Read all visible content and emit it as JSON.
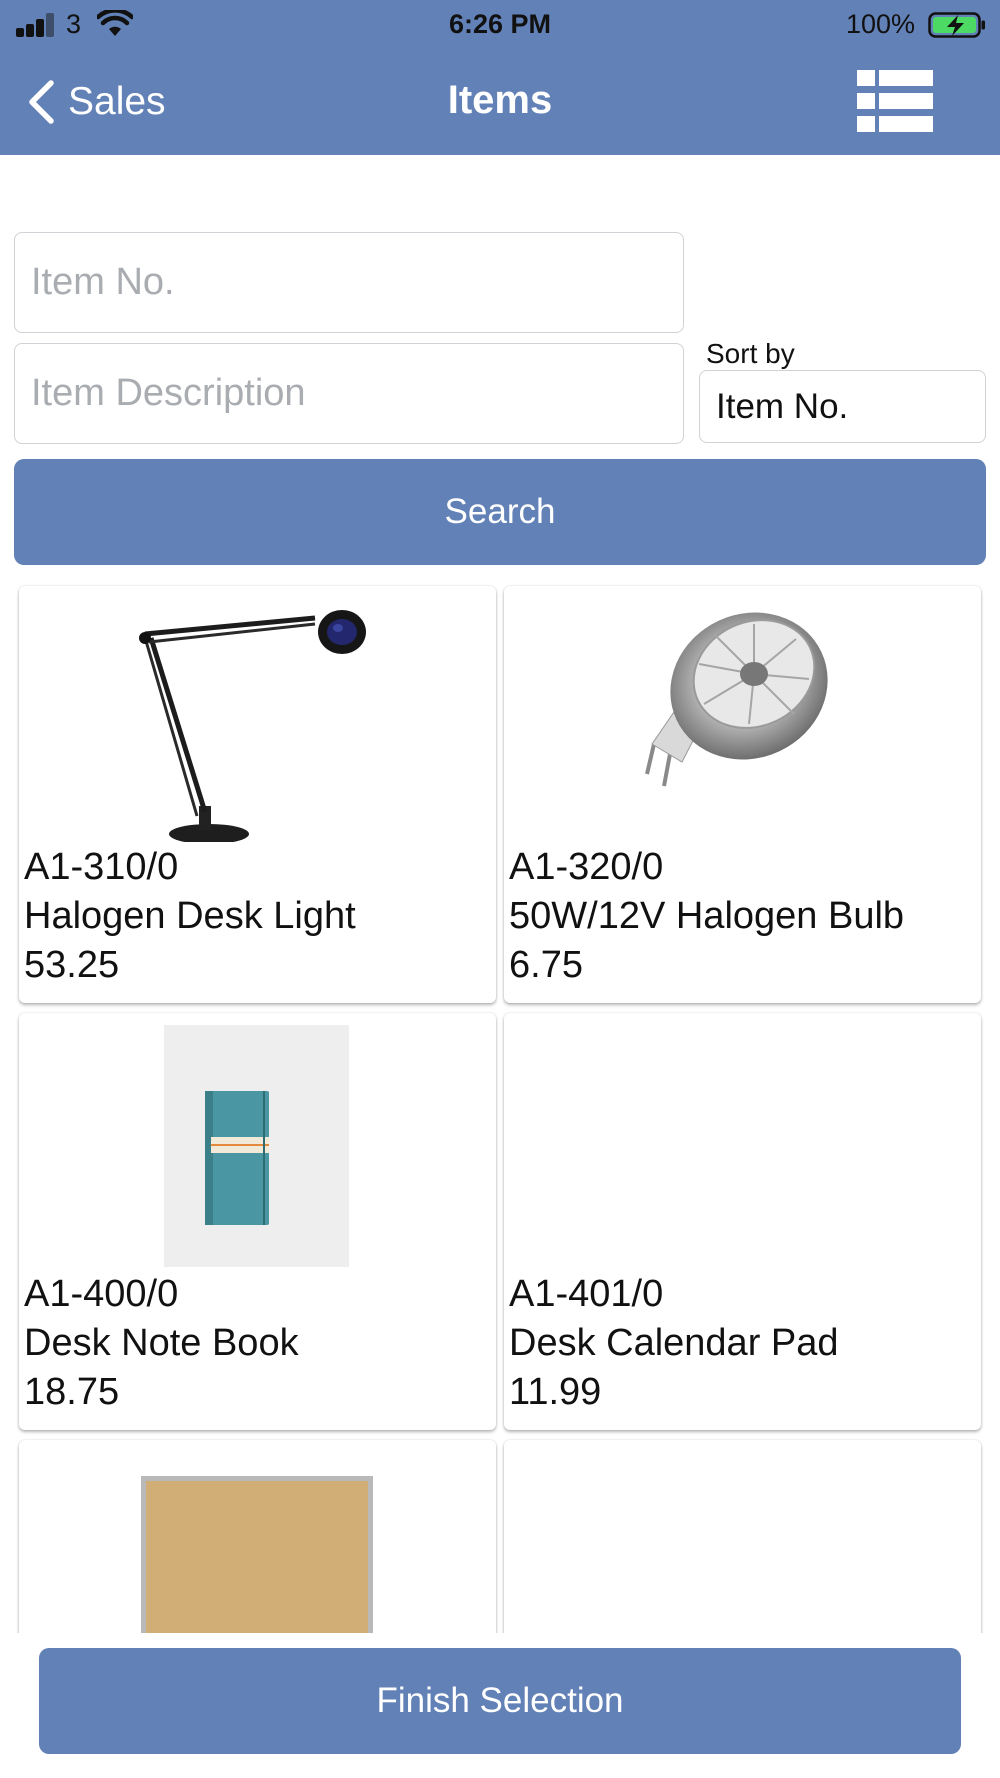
{
  "status_bar": {
    "carrier": "3",
    "time": "6:26 PM",
    "battery": "100%",
    "icons": [
      "signal-bars-icon",
      "wifi-icon",
      "battery-charging-icon"
    ]
  },
  "nav": {
    "back_label": "Sales",
    "title": "Items",
    "view_toggle_icon": "list-view-icon"
  },
  "search": {
    "item_no_placeholder": "Item No.",
    "item_no_value": "",
    "item_desc_placeholder": "Item Description",
    "item_desc_value": "",
    "sort_label": "Sort by",
    "sort_value": "Item No.",
    "button_label": "Search"
  },
  "items": [
    {
      "number": "A1-310/0",
      "description": "Halogen Desk Light",
      "price": "53.25",
      "image": "desk-lamp"
    },
    {
      "number": "A1-320/0",
      "description": "50W/12V Halogen Bulb",
      "price": "6.75",
      "image": "halogen-bulb"
    },
    {
      "number": "A1-400/0",
      "description": "Desk Note Book",
      "price": "18.75",
      "image": "notebook"
    },
    {
      "number": "A1-401/0",
      "description": "Desk Calendar Pad",
      "price": "11.99",
      "image": ""
    },
    {
      "number": "",
      "description": "",
      "price": "",
      "image": "cork-board"
    },
    {
      "number": "",
      "description": "",
      "price": "",
      "image": ""
    }
  ],
  "footer": {
    "finish_label": "Finish Selection"
  },
  "colors": {
    "accent": "#6281b6",
    "battery_fill": "#4cd964"
  }
}
